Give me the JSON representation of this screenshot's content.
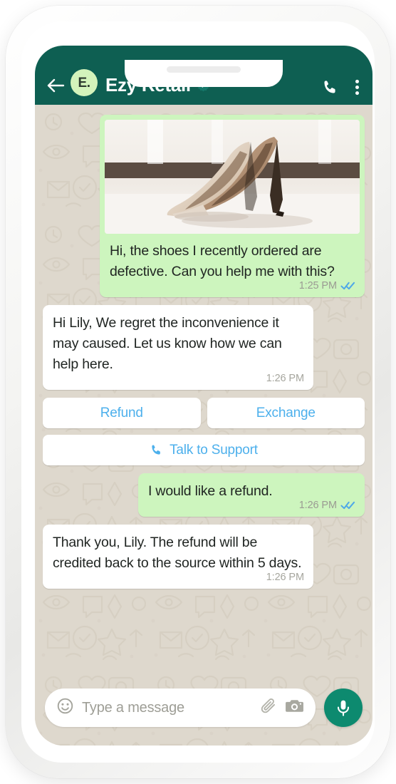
{
  "header": {
    "back_icon": "back-arrow-icon",
    "avatar_initials": "E.",
    "title": "Ezy Retail",
    "verified_icon": "verified-badge-icon",
    "call_icon": "phone-call-icon",
    "menu_icon": "overflow-menu-icon",
    "background_color": "#0e5f52"
  },
  "messages": [
    {
      "id": "msg-1",
      "direction": "out",
      "has_image": true,
      "image_alt": "beige high heel shoes",
      "text": "Hi, the shoes I recently ordered are defective. Can you help me with this?",
      "time": "1:25 PM",
      "status_icon": "double-check-read-icon"
    },
    {
      "id": "msg-2",
      "direction": "in",
      "has_image": false,
      "text": "Hi Lily, We regret the inconvenience it may caused. Let us know how we can help here.",
      "time": "1:26 PM",
      "status_icon": ""
    },
    {
      "id": "msg-3",
      "direction": "out",
      "has_image": false,
      "text": "I would like a refund.",
      "time": "1:26 PM",
      "status_icon": "double-check-read-icon"
    },
    {
      "id": "msg-4",
      "direction": "in",
      "has_image": false,
      "text": "Thank you, Lily. The refund will be credited back to the source within 5 days.",
      "time": "1:26 PM",
      "status_icon": ""
    }
  ],
  "quick_replies": {
    "refund": "Refund",
    "exchange": "Exchange",
    "talk_to_support": "Talk to Support",
    "support_icon": "phone-call-icon",
    "text_color": "#4db0ec"
  },
  "input_bar": {
    "emoji_icon": "emoji-smiley-icon",
    "placeholder": "Type a message",
    "attach_icon": "paperclip-icon",
    "camera_icon": "camera-icon",
    "mic_icon": "microphone-icon",
    "mic_button_color": "#0d8a6f"
  },
  "colors": {
    "header_green": "#0e5f52",
    "outgoing_bubble": "#cdf5be",
    "incoming_bubble": "#ffffff",
    "chat_background": "#ded8cd",
    "read_receipt_blue": "#4fa8e8",
    "link_blue": "#4db0ec"
  }
}
